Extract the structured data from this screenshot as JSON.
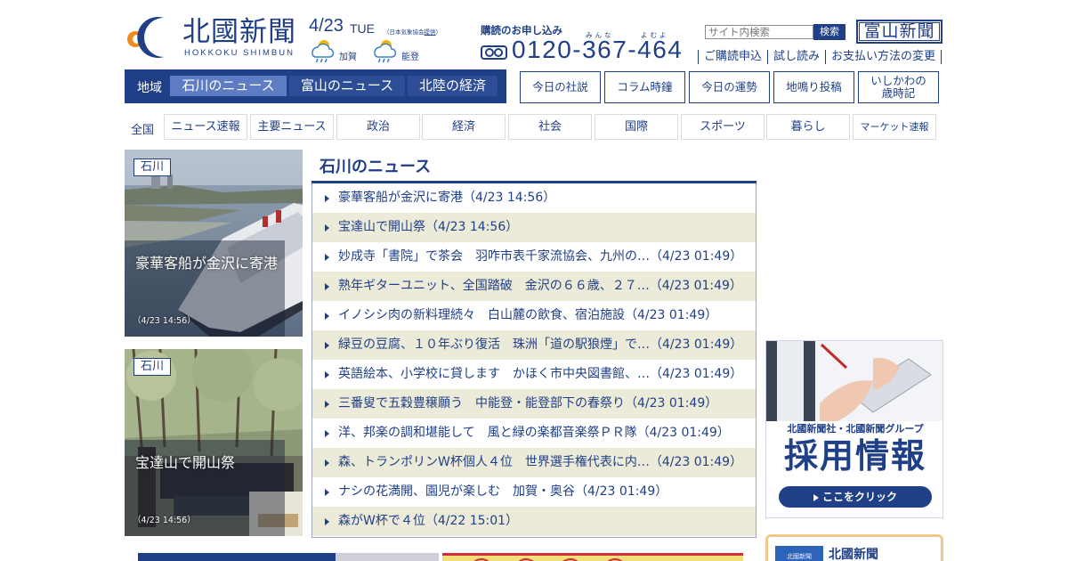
{
  "header": {
    "logo_kanji": "北國新聞",
    "logo_roman": "HOKKOKU SHIMBUN",
    "date": "4/23",
    "day_of_week": "TUE",
    "weather_note_prefix": "（日本気象協会",
    "weather_note_link": "提供",
    "weather_note_suffix": "）",
    "weather": [
      {
        "region": "加賀",
        "icon": "sun-rain-icon"
      },
      {
        "region": "能登",
        "icon": "sun-rain-icon"
      }
    ],
    "subscribe_title": "購読のお申し込み",
    "subscribe_ruby_1": "みんな",
    "subscribe_ruby_2": "よむよ",
    "phone": "0120-367-464",
    "search_placeholder": "サイト内検索",
    "search_button": "検索",
    "toyama_logo": "富山新聞",
    "util_links": [
      "ご購読申込",
      "試し読み",
      "お支払い方法の変更"
    ]
  },
  "region_nav": {
    "label": "地域",
    "tabs": [
      "石川のニュース",
      "富山のニュース",
      "北陸の経済"
    ],
    "active_index": 0
  },
  "feature_nav": [
    "今日の社説",
    "コラム時鐘",
    "今日の運勢",
    "地鳴り投稿",
    "いしかわの\n歳時記"
  ],
  "category_nav": {
    "label": "全国",
    "tabs": [
      "ニュース速報",
      "主要ニュース",
      "政治",
      "経済",
      "社会",
      "国際",
      "スポーツ",
      "暮らし",
      "マーケット速報"
    ]
  },
  "photos": [
    {
      "tag": "石川",
      "title": "豪華客船が金沢に寄港",
      "time": "（4/23 14:56）"
    },
    {
      "tag": "石川",
      "title": "宝達山で開山祭",
      "time": "（4/23 14:56）"
    }
  ],
  "news": {
    "heading": "石川のニュース",
    "items": [
      "豪華客船が金沢に寄港（4/23 14:56）",
      "宝達山で開山祭（4/23 14:56）",
      "妙成寺「書院」で茶会　羽咋市表千家流協会、九州の…（4/23 01:49）",
      "熟年ギターユニット、全国踏破　金沢の６６歳、２７…（4/23 01:49）",
      "イノシシ肉の新料理続々　白山麓の飲食、宿泊施設（4/23 01:49）",
      "緑豆の豆腐、１０年ぶり復活　珠洲「道の駅狼煙」で…（4/23 01:49）",
      "英語絵本、小学校に貸します　かほく市中央図書館、…（4/23 01:49）",
      "三番叟で五穀豊穣願う　中能登・能登部下の春祭り（4/23 01:49）",
      "洋、邦楽の調和堪能して　風と緑の楽都音楽祭ＰＲ隊（4/23 01:49）",
      "森、トランポリンW杯個人４位　世界選手権代表に内…（4/23 01:49）",
      "ナシの花満開、園児が楽しむ　加賀・奥谷（4/23 01:49）",
      "森がW杯で４位（4/22 15:01）"
    ]
  },
  "recruit_ad": {
    "subtitle": "北國新聞社・北國新聞グループ",
    "title": "採用情報",
    "button": "ここをクリック"
  },
  "promo_box": {
    "logo_text": "北國新聞",
    "title": "北國新聞"
  },
  "colors": {
    "brand_navy": "#1f3f86",
    "active_tab": "#5d7cc4",
    "row_alt": "#ecebd9",
    "logo_orange": "#f08a1c"
  }
}
